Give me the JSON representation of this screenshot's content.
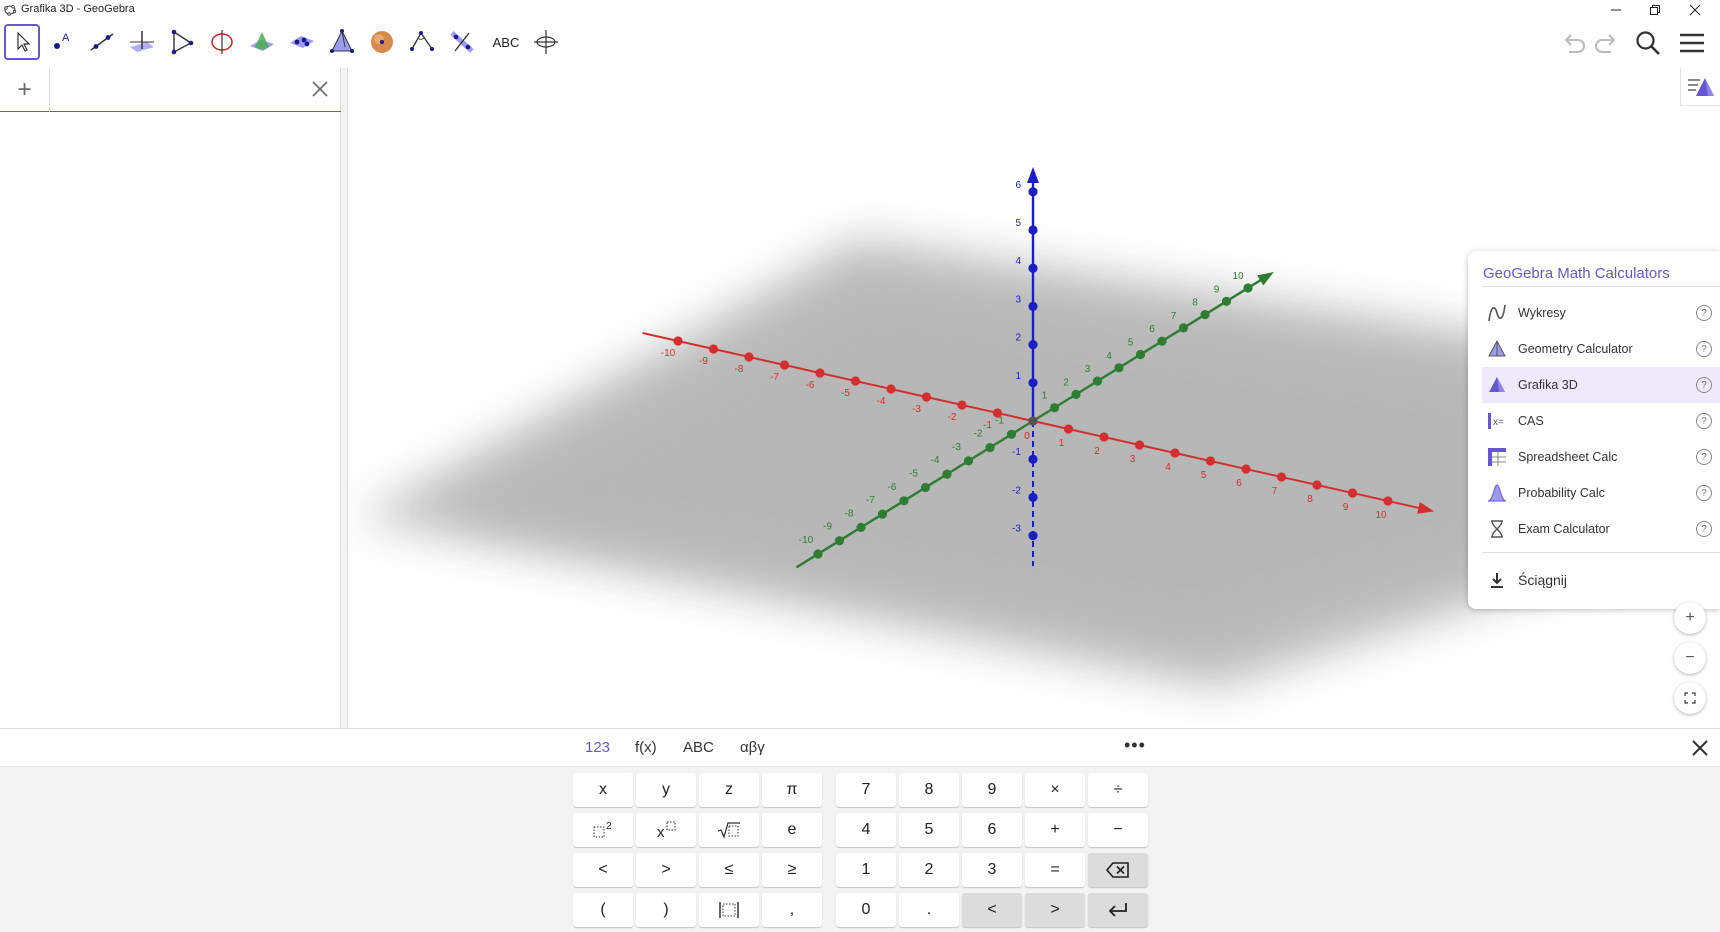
{
  "window": {
    "title": "Grafika 3D - GeoGebra"
  },
  "algebra": {
    "add_label": "+"
  },
  "axes": {
    "x_labels_neg": [
      "-10",
      "-9",
      "-8",
      "-7",
      "-6",
      "-5",
      "-4",
      "-3",
      "-2",
      "-1"
    ],
    "x_labels_pos": [
      "1",
      "2",
      "3",
      "4",
      "5",
      "6",
      "7",
      "8",
      "9",
      "10"
    ],
    "y_labels_neg": [
      "-10",
      "-9",
      "-8",
      "-7",
      "-6",
      "-5",
      "-4",
      "-3",
      "-2",
      "-1"
    ],
    "y_labels_pos": [
      "1",
      "2",
      "3",
      "4",
      "5",
      "6",
      "7",
      "8",
      "9",
      "10"
    ],
    "z_labels": [
      "6",
      "5",
      "4",
      "3",
      "2",
      "1",
      "-1",
      "-2",
      "-3"
    ],
    "origin": "0",
    "x_color": "#d32f2f",
    "y_color": "#2e7d32",
    "z_color": "#1a1fc4"
  },
  "toolbar": {
    "text_tool_label": "ABC",
    "accent": "#6557d2"
  },
  "calc_menu": {
    "title": "GeoGebra Math Calculators",
    "items": [
      {
        "label": "Wykresy",
        "icon": "graphing-icon"
      },
      {
        "label": "Geometry Calculator",
        "icon": "geometry-icon"
      },
      {
        "label": "Grafika 3D",
        "icon": "3d-graphics-icon",
        "selected": true
      },
      {
        "label": "CAS",
        "icon": "cas-icon"
      },
      {
        "label": "Spreadsheet Calc",
        "icon": "spreadsheet-icon"
      },
      {
        "label": "Probability Calc",
        "icon": "probability-icon"
      },
      {
        "label": "Exam Calculator",
        "icon": "exam-icon"
      }
    ],
    "download_label": "Ściągnij",
    "help_glyph": "?"
  },
  "zoom": {
    "in": "+",
    "out": "−"
  },
  "keyboard": {
    "tabs": [
      "123",
      "f(x)",
      "ABC",
      "αβγ"
    ],
    "more": "•••",
    "row1_left": [
      "x",
      "y",
      "z",
      "π"
    ],
    "row2_left": [
      "e"
    ],
    "row3_left": [
      "<",
      ">",
      "≤",
      "≥"
    ],
    "row4_left": [
      "(",
      ")",
      ","
    ],
    "row1_right": [
      "7",
      "8",
      "9",
      "×",
      "÷"
    ],
    "row2_right": [
      "4",
      "5",
      "6",
      "+",
      "−"
    ],
    "row3_right": [
      "1",
      "2",
      "3",
      "="
    ],
    "row4_right": [
      "0",
      ".",
      "<",
      ">"
    ]
  }
}
